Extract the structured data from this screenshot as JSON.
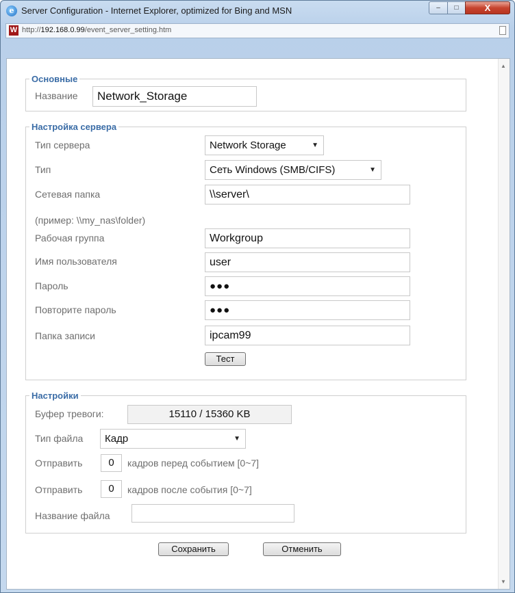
{
  "window": {
    "title": "Server Configuration - Internet Explorer, optimized for Bing and MSN",
    "url_prefix": "http://",
    "url_host": "192.168.0.99",
    "url_path": "/event_server_setting.htm",
    "min_glyph": "–",
    "max_glyph": "□",
    "close_glyph": "X"
  },
  "basic": {
    "legend": "Основные",
    "name_label": "Название",
    "name_value": "Network_Storage"
  },
  "server": {
    "legend": "Настройка сервера",
    "server_type_label": "Тип сервера",
    "server_type_value": "Network Storage",
    "type_label": "Тип",
    "type_value": "Сеть Windows (SMB/CIFS)",
    "network_folder_label": "Сетевая папка",
    "network_folder_value": "\\\\server\\",
    "example_hint": "(пример: \\\\my_nas\\folder)",
    "workgroup_label": "Рабочая группа",
    "workgroup_value": "Workgroup",
    "username_label": "Имя пользователя",
    "username_value": "user",
    "password_label": "Пароль",
    "password_value": "●●●",
    "repeat_password_label": "Повторите пароль",
    "repeat_password_value": "●●●",
    "record_folder_label": "Папка записи",
    "record_folder_value": "ipcam99",
    "test_button": "Тест"
  },
  "settings": {
    "legend": "Настройки",
    "buffer_label": "Буфер тревоги:",
    "buffer_value": "15110 / 15360 KB",
    "file_type_label": "Тип файла",
    "file_type_value": "Кадр",
    "send_label": "Отправить",
    "frames_before_value": "0",
    "frames_before_text": "кадров перед событием [0~7]",
    "frames_after_value": "0",
    "frames_after_text": "кадров после события [0~7]",
    "filename_label": "Название файла",
    "filename_value": ""
  },
  "actions": {
    "save": "Сохранить",
    "cancel": "Отменить"
  }
}
